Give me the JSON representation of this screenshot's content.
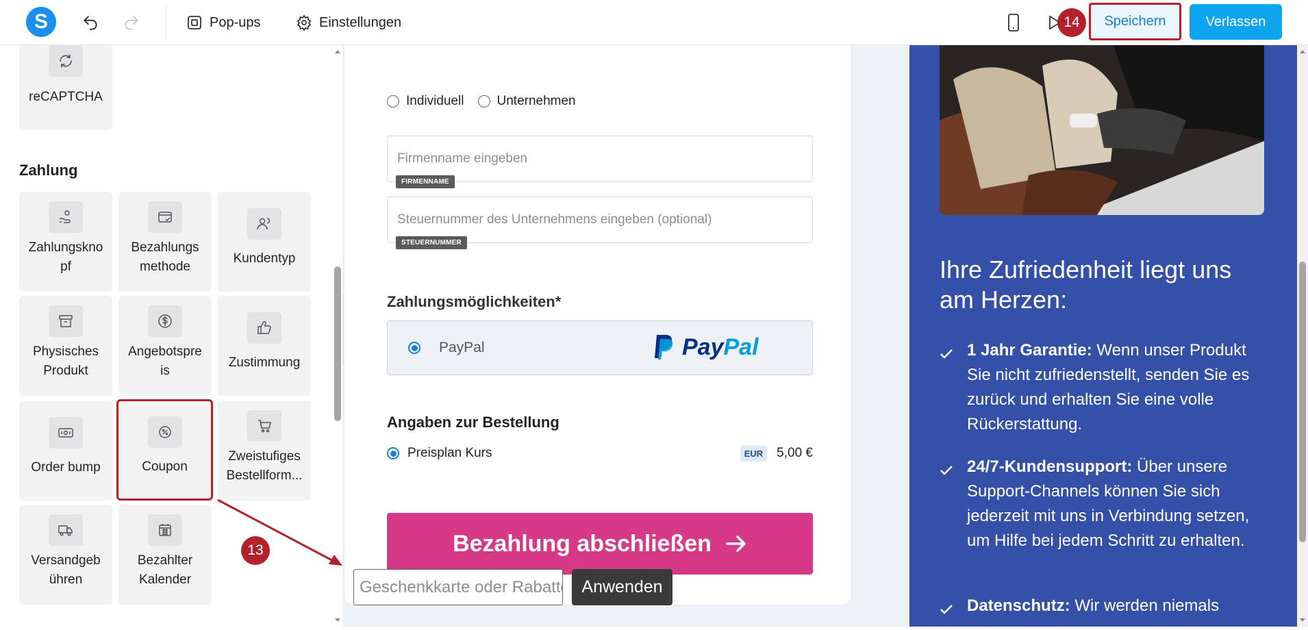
{
  "topbar": {
    "logo_letter": "S",
    "popups_label": "Pop-ups",
    "settings_label": "Einstellungen",
    "save_label": "Speichern",
    "leave_label": "Verlassen"
  },
  "annotations": {
    "step_13": "13",
    "step_14": "14"
  },
  "sidebar": {
    "recaptcha_label": "reCAPTCHA",
    "section_title": "Zahlung",
    "tiles": [
      {
        "label": "Zahlungsknopf",
        "icon": "hand-coins-icon"
      },
      {
        "label": "Bezahlungsmethode",
        "icon": "credit-card-check-icon"
      },
      {
        "label": "Kundentyp",
        "icon": "users-icon"
      },
      {
        "label": "Physisches Produkt",
        "icon": "archive-box-icon"
      },
      {
        "label": "Angebotspreis",
        "icon": "dollar-coin-icon"
      },
      {
        "label": "Zustimmung",
        "icon": "thumbs-up-icon"
      },
      {
        "label": "Order bump",
        "icon": "banknote-icon"
      },
      {
        "label": "Coupon",
        "icon": "percent-badge-icon"
      },
      {
        "label": "Zweistufiges Bestellform...",
        "icon": "shopping-cart-icon"
      },
      {
        "label": "Versandgebühren",
        "icon": "truck-icon"
      },
      {
        "label": "Bezahlter Kalender",
        "icon": "calendar-icon"
      }
    ]
  },
  "form": {
    "customer_type_options": [
      "Individuell",
      "Unternehmen"
    ],
    "company_placeholder": "Firmenname eingeben",
    "company_tag": "FIRMENNAME",
    "tax_placeholder": "Steuernummer des Unternehmens eingeben (optional)",
    "tax_tag": "STEUERNUMMER",
    "payment_options_title": "Zahlungsmöglichkeiten*",
    "paypal_label": "PayPal",
    "paypal_logo_pay": "Pay",
    "paypal_logo_pal": "Pal",
    "order_details_title": "Angaben zur Bestellung",
    "price_plan_label": "Preisplan Kurs",
    "currency_badge": "EUR",
    "price": "5,00 €",
    "submit_label": "Bezahlung abschließen",
    "coupon_placeholder": "Geschenkkarte oder Rabattcode",
    "apply_label": "Anwenden"
  },
  "right_panel": {
    "title": "Ihre Zufriedenheit liegt uns am Herzen:",
    "features": [
      {
        "bold": "1 Jahr Garantie:",
        "text": "  Wenn unser Produkt Sie nicht zufriedenstellt, senden Sie es zurück und erhalten Sie eine volle Rückerstattung."
      },
      {
        "bold": "24/7-Kundensupport:",
        "text": " Über unsere Support-Channels können Sie sich jederzeit mit uns in Verbindung setzen, um Hilfe bei jedem Schritt zu erhalten."
      },
      {
        "bold": "Datenschutz:",
        "text": " Wir werden niemals"
      }
    ]
  },
  "colors": {
    "accent_blue": "#0ea5f0",
    "highlight_red": "#b3222c",
    "pay_button": "#d63a87",
    "right_panel_bg": "#3450a8"
  }
}
